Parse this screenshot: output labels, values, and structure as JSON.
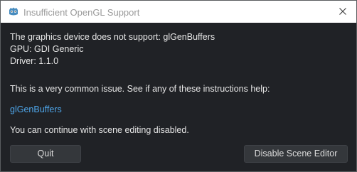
{
  "window": {
    "title": "Insufficient OpenGL Support",
    "icon": "godot-engine-icon",
    "close_icon": "close-icon"
  },
  "message": {
    "line1": "The graphics device does not support: glGenBuffers",
    "line2": "GPU: GDI Generic",
    "line3": "Driver: 1.1.0",
    "hint": "This is a very common issue. See if any of these instructions help:",
    "link": "glGenBuffers",
    "continue": "You can continue with scene editing disabled."
  },
  "buttons": {
    "quit": "Quit",
    "disable": "Disable Scene Editor"
  },
  "colors": {
    "background": "#202226",
    "link": "#4ea6ea",
    "button": "#34373b",
    "titlebar": "#ffffff"
  }
}
